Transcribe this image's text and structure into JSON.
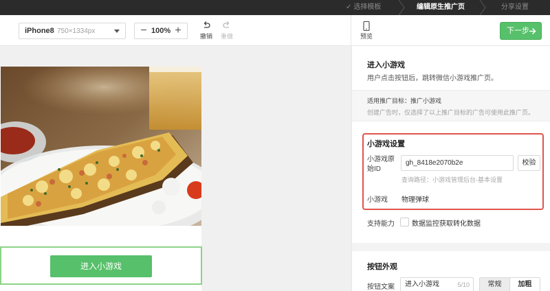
{
  "steps": [
    {
      "label": "选择模板",
      "done": true
    },
    {
      "label": "编辑原生推广页",
      "active": true
    },
    {
      "label": "分享设置"
    }
  ],
  "toolbar": {
    "device_name": "iPhone8",
    "device_resolution": "750×1334px",
    "zoom_value": "100%",
    "undo_label": "撤销",
    "redo_label": "重做",
    "preview_label": "预览",
    "next_label": "下一步"
  },
  "preview": {
    "game_button_label": "进入小游戏"
  },
  "panel": {
    "title": "进入小游戏",
    "subtitle": "用户点击按钮后，跳转微信小游戏推广页。",
    "target_line": "适用推广目标：推广小游戏",
    "target_note": "创建广告时，仅选择了以上推广目标的广告可使用此推广页。",
    "game_settings_heading": "小游戏设置",
    "original_id_label": "小游戏原始ID",
    "original_id_value": "gh_8418e2070b2e",
    "verify_label": "校验",
    "query_hint": "查询路径：小游戏管理后台-基本设置",
    "game_label": "小游戏",
    "game_name": "物理弹球",
    "capability_label": "支持能力",
    "capability_option": "数据监控获取转化数据",
    "appearance_heading": "按钮外观",
    "button_text_label": "按钮文案",
    "button_text_value": "进入小游戏",
    "button_text_count": "5/10",
    "style_normal": "常规",
    "style_bold": "加粗"
  },
  "colors": {
    "accent_green": "#57c06a",
    "highlight_red": "#e2544a",
    "topbar": "#2b2b2b"
  }
}
